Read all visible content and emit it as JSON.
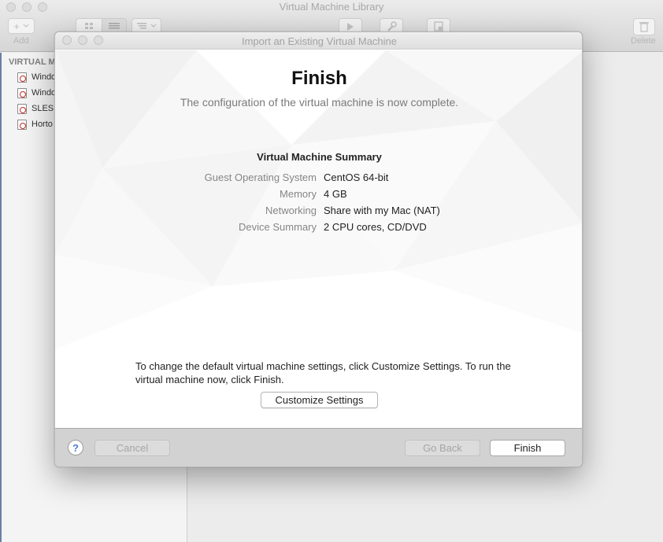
{
  "library": {
    "title": "Virtual Machine Library",
    "toolbar": {
      "add_symbol": "+",
      "add_label": "Add",
      "delete_label": "Delete"
    },
    "sidebar": {
      "header": "VIRTUAL M",
      "items": [
        {
          "label": "Windo"
        },
        {
          "label": "Windo"
        },
        {
          "label": "SLES"
        },
        {
          "label": "Horto"
        }
      ]
    }
  },
  "dialog": {
    "title": "Import an Existing Virtual Machine",
    "heading": "Finish",
    "subheading": "The configuration of the virtual machine is now complete.",
    "summary": {
      "title": "Virtual Machine Summary",
      "rows": [
        {
          "label": "Guest Operating System",
          "value": "CentOS 64-bit"
        },
        {
          "label": "Memory",
          "value": "4 GB"
        },
        {
          "label": "Networking",
          "value": "Share with my Mac (NAT)"
        },
        {
          "label": "Device Summary",
          "value": "2 CPU cores, CD/DVD"
        }
      ]
    },
    "hint": "To change the default virtual machine settings, click Customize Settings. To run the virtual machine now, click Finish.",
    "customize_label": "Customize Settings",
    "footer": {
      "help_symbol": "?",
      "cancel_label": "Cancel",
      "go_back_label": "Go Back",
      "finish_label": "Finish"
    }
  }
}
